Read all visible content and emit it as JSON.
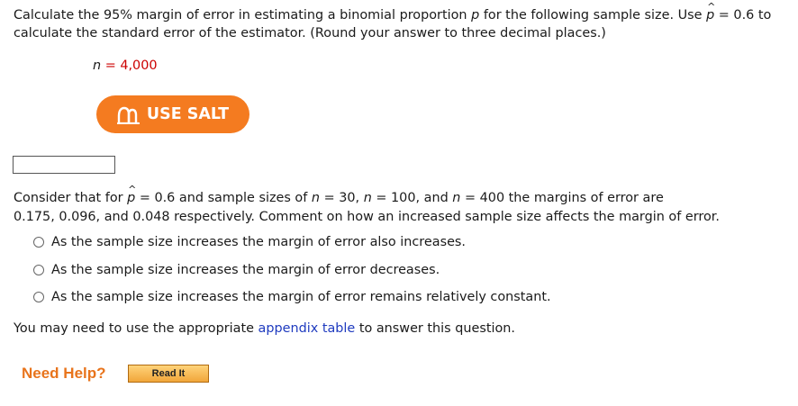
{
  "question1": {
    "line1_a": "Calculate the 95% margin of error in estimating a binomial proportion ",
    "line1_p": "p",
    "line1_b": " for the following sample size. Use ",
    "line1_phat": "p",
    "line1_c": " = 0.6 to",
    "line2": "calculate the standard error of the estimator. (Round your answer to three decimal places.)",
    "n_var": "n",
    "n_eq": " = 4,000"
  },
  "salt_button": {
    "label": "USE SALT"
  },
  "answer": {
    "value": ""
  },
  "question2": {
    "l1_a": "Consider that for ",
    "l1_phat": "p",
    "l1_b": " = 0.6 and sample sizes of ",
    "l1_n1": "n",
    "l1_c": " = 30, ",
    "l1_n2": "n",
    "l1_d": " = 100, and ",
    "l1_n3": "n",
    "l1_e": " = 400 the margins of error are",
    "l2": "0.175, 0.096, and 0.048 respectively. Comment on how an increased sample size affects the margin of error.",
    "options": [
      "As the sample size increases the margin of error also increases.",
      "As the sample size increases the margin of error decreases.",
      "As the sample size increases the margin of error remains relatively constant."
    ]
  },
  "appendix": {
    "before": "You may need to use the appropriate ",
    "link": "appendix table",
    "after": " to answer this question."
  },
  "help": {
    "label": "Need Help?",
    "read_it": "Read It"
  }
}
